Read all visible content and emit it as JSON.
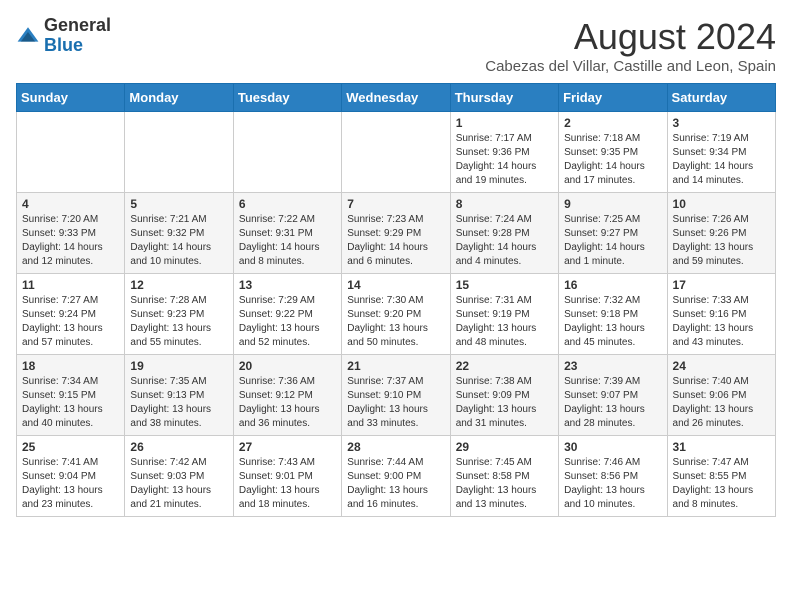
{
  "header": {
    "logo_line1": "General",
    "logo_line2": "Blue",
    "title": "August 2024",
    "subtitle": "Cabezas del Villar, Castille and Leon, Spain"
  },
  "days_of_week": [
    "Sunday",
    "Monday",
    "Tuesday",
    "Wednesday",
    "Thursday",
    "Friday",
    "Saturday"
  ],
  "weeks": [
    [
      {
        "day": "",
        "info": ""
      },
      {
        "day": "",
        "info": ""
      },
      {
        "day": "",
        "info": ""
      },
      {
        "day": "",
        "info": ""
      },
      {
        "day": "1",
        "info": "Sunrise: 7:17 AM\nSunset: 9:36 PM\nDaylight: 14 hours and 19 minutes."
      },
      {
        "day": "2",
        "info": "Sunrise: 7:18 AM\nSunset: 9:35 PM\nDaylight: 14 hours and 17 minutes."
      },
      {
        "day": "3",
        "info": "Sunrise: 7:19 AM\nSunset: 9:34 PM\nDaylight: 14 hours and 14 minutes."
      }
    ],
    [
      {
        "day": "4",
        "info": "Sunrise: 7:20 AM\nSunset: 9:33 PM\nDaylight: 14 hours and 12 minutes."
      },
      {
        "day": "5",
        "info": "Sunrise: 7:21 AM\nSunset: 9:32 PM\nDaylight: 14 hours and 10 minutes."
      },
      {
        "day": "6",
        "info": "Sunrise: 7:22 AM\nSunset: 9:31 PM\nDaylight: 14 hours and 8 minutes."
      },
      {
        "day": "7",
        "info": "Sunrise: 7:23 AM\nSunset: 9:29 PM\nDaylight: 14 hours and 6 minutes."
      },
      {
        "day": "8",
        "info": "Sunrise: 7:24 AM\nSunset: 9:28 PM\nDaylight: 14 hours and 4 minutes."
      },
      {
        "day": "9",
        "info": "Sunrise: 7:25 AM\nSunset: 9:27 PM\nDaylight: 14 hours and 1 minute."
      },
      {
        "day": "10",
        "info": "Sunrise: 7:26 AM\nSunset: 9:26 PM\nDaylight: 13 hours and 59 minutes."
      }
    ],
    [
      {
        "day": "11",
        "info": "Sunrise: 7:27 AM\nSunset: 9:24 PM\nDaylight: 13 hours and 57 minutes."
      },
      {
        "day": "12",
        "info": "Sunrise: 7:28 AM\nSunset: 9:23 PM\nDaylight: 13 hours and 55 minutes."
      },
      {
        "day": "13",
        "info": "Sunrise: 7:29 AM\nSunset: 9:22 PM\nDaylight: 13 hours and 52 minutes."
      },
      {
        "day": "14",
        "info": "Sunrise: 7:30 AM\nSunset: 9:20 PM\nDaylight: 13 hours and 50 minutes."
      },
      {
        "day": "15",
        "info": "Sunrise: 7:31 AM\nSunset: 9:19 PM\nDaylight: 13 hours and 48 minutes."
      },
      {
        "day": "16",
        "info": "Sunrise: 7:32 AM\nSunset: 9:18 PM\nDaylight: 13 hours and 45 minutes."
      },
      {
        "day": "17",
        "info": "Sunrise: 7:33 AM\nSunset: 9:16 PM\nDaylight: 13 hours and 43 minutes."
      }
    ],
    [
      {
        "day": "18",
        "info": "Sunrise: 7:34 AM\nSunset: 9:15 PM\nDaylight: 13 hours and 40 minutes."
      },
      {
        "day": "19",
        "info": "Sunrise: 7:35 AM\nSunset: 9:13 PM\nDaylight: 13 hours and 38 minutes."
      },
      {
        "day": "20",
        "info": "Sunrise: 7:36 AM\nSunset: 9:12 PM\nDaylight: 13 hours and 36 minutes."
      },
      {
        "day": "21",
        "info": "Sunrise: 7:37 AM\nSunset: 9:10 PM\nDaylight: 13 hours and 33 minutes."
      },
      {
        "day": "22",
        "info": "Sunrise: 7:38 AM\nSunset: 9:09 PM\nDaylight: 13 hours and 31 minutes."
      },
      {
        "day": "23",
        "info": "Sunrise: 7:39 AM\nSunset: 9:07 PM\nDaylight: 13 hours and 28 minutes."
      },
      {
        "day": "24",
        "info": "Sunrise: 7:40 AM\nSunset: 9:06 PM\nDaylight: 13 hours and 26 minutes."
      }
    ],
    [
      {
        "day": "25",
        "info": "Sunrise: 7:41 AM\nSunset: 9:04 PM\nDaylight: 13 hours and 23 minutes."
      },
      {
        "day": "26",
        "info": "Sunrise: 7:42 AM\nSunset: 9:03 PM\nDaylight: 13 hours and 21 minutes."
      },
      {
        "day": "27",
        "info": "Sunrise: 7:43 AM\nSunset: 9:01 PM\nDaylight: 13 hours and 18 minutes."
      },
      {
        "day": "28",
        "info": "Sunrise: 7:44 AM\nSunset: 9:00 PM\nDaylight: 13 hours and 16 minutes."
      },
      {
        "day": "29",
        "info": "Sunrise: 7:45 AM\nSunset: 8:58 PM\nDaylight: 13 hours and 13 minutes."
      },
      {
        "day": "30",
        "info": "Sunrise: 7:46 AM\nSunset: 8:56 PM\nDaylight: 13 hours and 10 minutes."
      },
      {
        "day": "31",
        "info": "Sunrise: 7:47 AM\nSunset: 8:55 PM\nDaylight: 13 hours and 8 minutes."
      }
    ]
  ]
}
